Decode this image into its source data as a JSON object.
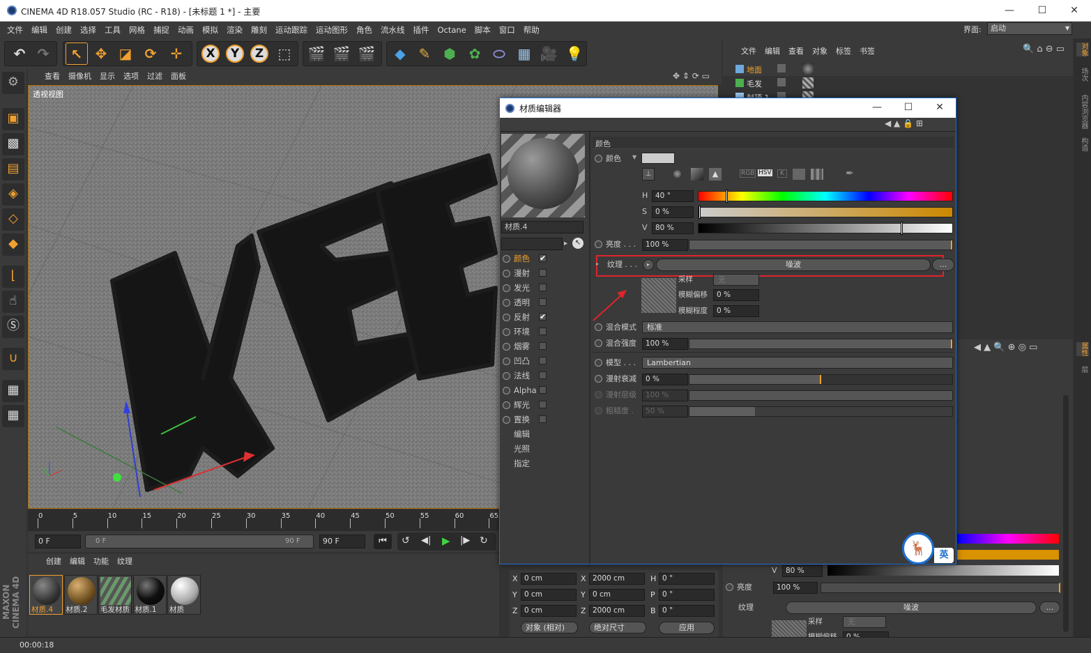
{
  "app": {
    "title": "CINEMA 4D R18.057 Studio (RC - R18) - [未标题 1 *] - 主要",
    "minimize": "—",
    "maximize": "☐",
    "close": "✕"
  },
  "menu": [
    "文件",
    "编辑",
    "创建",
    "选择",
    "工具",
    "网格",
    "捕捉",
    "动画",
    "模拟",
    "渲染",
    "雕刻",
    "运动跟踪",
    "运动图形",
    "角色",
    "流水线",
    "插件",
    "Octane",
    "脚本",
    "窗口",
    "帮助"
  ],
  "layout": {
    "label": "界面:",
    "value": "启动"
  },
  "viewport": {
    "menu": [
      "查看",
      "摄像机",
      "显示",
      "选项",
      "过滤",
      "面板"
    ],
    "name": "透视视图"
  },
  "timeline": {
    "ticks": [
      "0",
      "5",
      "10",
      "15",
      "20",
      "25",
      "30",
      "35",
      "40",
      "45",
      "50",
      "55",
      "60",
      "65"
    ],
    "start": "0 F",
    "range_start": "0 F",
    "range_end": "90 F",
    "end": "90 F"
  },
  "materials": {
    "menu": [
      "创建",
      "编辑",
      "功能",
      "纹理"
    ],
    "items": [
      "材质.4",
      "材质.2",
      "毛发材质",
      "材质.1",
      "材质"
    ]
  },
  "status": {
    "time": "00:00:18"
  },
  "objmgr": {
    "menu": [
      "文件",
      "编辑",
      "查看",
      "对象",
      "标签",
      "书签"
    ],
    "objects": [
      "地面",
      "毛发",
      "封顶.1"
    ]
  },
  "right_tabs": [
    "对象",
    "场次",
    "内容浏览器",
    "构造",
    "属性",
    "层"
  ],
  "coord": {
    "rows": [
      {
        "a": "X",
        "av": "0 cm",
        "b": "X",
        "bv": "2000 cm",
        "c": "H",
        "cv": "0 °"
      },
      {
        "a": "Y",
        "av": "0 cm",
        "b": "Y",
        "bv": "0 cm",
        "c": "P",
        "cv": "0 °"
      },
      {
        "a": "Z",
        "av": "0 cm",
        "b": "Z",
        "bv": "2000 cm",
        "c": "B",
        "cv": "0 °"
      }
    ],
    "mode": "对象 (相对)",
    "size": "绝对尺寸",
    "apply": "应用"
  },
  "attr_behind": {
    "v_label": "V",
    "v_value": "80 %",
    "brightness_label": "亮度",
    "brightness_value": "100 %",
    "texture_label": "纹理",
    "texture_value": "噪波",
    "more": "...",
    "sampling": "采样",
    "sampling_value": "无",
    "blur_offset": "模糊偏移",
    "blur_offset_value": "0 %"
  },
  "editor": {
    "title": "材质编辑器",
    "minimize": "—",
    "maximize": "☐",
    "close": "✕",
    "material_name": "材质.4",
    "channels": [
      {
        "name": "颜色",
        "checked": true,
        "active": true
      },
      {
        "name": "漫射",
        "checked": false
      },
      {
        "name": "发光",
        "checked": false
      },
      {
        "name": "透明",
        "checked": false
      },
      {
        "name": "反射",
        "checked": true
      },
      {
        "name": "环境",
        "checked": false
      },
      {
        "name": "烟雾",
        "checked": false
      },
      {
        "name": "凹凸",
        "checked": false
      },
      {
        "name": "法线",
        "checked": false
      },
      {
        "name": "Alpha",
        "checked": false
      },
      {
        "name": "辉光",
        "checked": false
      },
      {
        "name": "置换",
        "checked": false
      }
    ],
    "extra": [
      "编辑",
      "光照",
      "指定"
    ],
    "section": "颜色",
    "color_label": "颜色",
    "modes": [
      "RGB",
      "HSV",
      "K"
    ],
    "h": {
      "label": "H",
      "value": "40 °",
      "level": 0.111
    },
    "s": {
      "label": "S",
      "value": "0 %",
      "level": 0
    },
    "v": {
      "label": "V",
      "value": "80 %",
      "level": 0.8
    },
    "brightness": {
      "label": "亮度 . . .",
      "value": "100 %",
      "level": 1
    },
    "texture": {
      "label": "纹理 . . .",
      "value": "噪波",
      "more": "..."
    },
    "sampling": {
      "label": "采样",
      "value": "无"
    },
    "blur_offset": {
      "label": "模糊偏移",
      "value": "0 %"
    },
    "blur_amount": {
      "label": "模糊程度",
      "value": "0 %"
    },
    "blend_mode": {
      "label": "混合模式",
      "value": "标准"
    },
    "blend_strength": {
      "label": "混合强度",
      "value": "100 %",
      "level": 1
    },
    "model": {
      "label": "模型 . . .",
      "value": "Lambertian"
    },
    "diffuse_falloff": {
      "label": "漫射衰减",
      "value": "0 %",
      "level": 0.5
    },
    "diffuse_level": {
      "label": "漫射层级",
      "value": "100 %"
    },
    "roughness": {
      "label": "粗糙度 .",
      "value": "50 %",
      "level": 0.25
    }
  },
  "ime": {
    "label": "英"
  },
  "colors": {
    "accent": "#f0a030",
    "highlight_box": "#e0242c",
    "selection": "#1d6fd1"
  }
}
